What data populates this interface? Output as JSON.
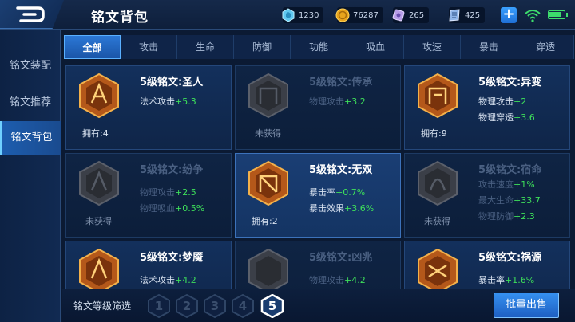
{
  "header": {
    "title": "铭文背包",
    "resources": [
      {
        "name": "crystal",
        "icon": "crystal-icon",
        "value": "1230"
      },
      {
        "name": "gold",
        "icon": "gold-coin-icon",
        "value": "76287"
      },
      {
        "name": "gem",
        "icon": "gem-icon",
        "value": "265"
      },
      {
        "name": "rune-fragment",
        "icon": "rune-fragment-icon",
        "value": "425"
      }
    ]
  },
  "sidebar": {
    "items": [
      {
        "label": "铭文装配",
        "active": false
      },
      {
        "label": "铭文推荐",
        "active": false
      },
      {
        "label": "铭文背包",
        "active": true
      }
    ]
  },
  "tabs": [
    "全部",
    "攻击",
    "生命",
    "防御",
    "功能",
    "吸血",
    "攻速",
    "暴击",
    "穿透"
  ],
  "active_tab": "全部",
  "cards": [
    {
      "name": "5级铭文:圣人",
      "locked": false,
      "active": false,
      "rune_color": "orange",
      "stats": [
        {
          "label": "法术攻击",
          "value": "+5.3"
        }
      ],
      "owned": "拥有:4"
    },
    {
      "name": "5级铭文:传承",
      "locked": true,
      "active": false,
      "rune_color": "grey",
      "stats": [
        {
          "label": "物理攻击",
          "value": "+3.2"
        }
      ],
      "owned": "未获得"
    },
    {
      "name": "5级铭文:异变",
      "locked": false,
      "active": false,
      "rune_color": "orange",
      "stats": [
        {
          "label": "物理攻击",
          "value": "+2"
        },
        {
          "label": "物理穿透",
          "value": "+3.6"
        }
      ],
      "owned": "拥有:9"
    },
    {
      "name": "5级铭文:纷争",
      "locked": true,
      "active": false,
      "rune_color": "grey",
      "stats": [
        {
          "label": "物理攻击",
          "value": "+2.5"
        },
        {
          "label": "物理吸血",
          "value": "+0.5%"
        }
      ],
      "owned": "未获得"
    },
    {
      "name": "5级铭文:无双",
      "locked": false,
      "active": true,
      "rune_color": "orange",
      "stats": [
        {
          "label": "暴击率",
          "value": "+0.7%"
        },
        {
          "label": "暴击效果",
          "value": "+3.6%"
        }
      ],
      "owned": "拥有:2"
    },
    {
      "name": "5级铭文:宿命",
      "locked": true,
      "active": false,
      "rune_color": "grey",
      "stats": [
        {
          "label": "攻击速度",
          "value": "+1%"
        },
        {
          "label": "最大生命",
          "value": "+33.7"
        },
        {
          "label": "物理防御",
          "value": "+2.3"
        }
      ],
      "owned": "未获得"
    },
    {
      "name": "5级铭文:梦魇",
      "locked": false,
      "active": false,
      "rune_color": "orange",
      "stats": [
        {
          "label": "法术攻击",
          "value": "+4.2"
        }
      ],
      "owned": ""
    },
    {
      "name": "5级铭文:凶兆",
      "locked": true,
      "active": false,
      "rune_color": "grey",
      "stats": [
        {
          "label": "物理攻击",
          "value": "+4.2"
        }
      ],
      "owned": ""
    },
    {
      "name": "5级铭文:祸源",
      "locked": false,
      "active": false,
      "rune_color": "orange",
      "stats": [
        {
          "label": "暴击率",
          "value": "+1.6%"
        }
      ],
      "owned": ""
    }
  ],
  "bottom": {
    "filter_label": "铭文等级筛选",
    "levels": [
      "1",
      "2",
      "3",
      "4",
      "5"
    ],
    "active_level": "5",
    "sell_label": "批量出售"
  },
  "colors": {
    "stat_value": "#3ee05a",
    "accent": "#2c78d6"
  }
}
